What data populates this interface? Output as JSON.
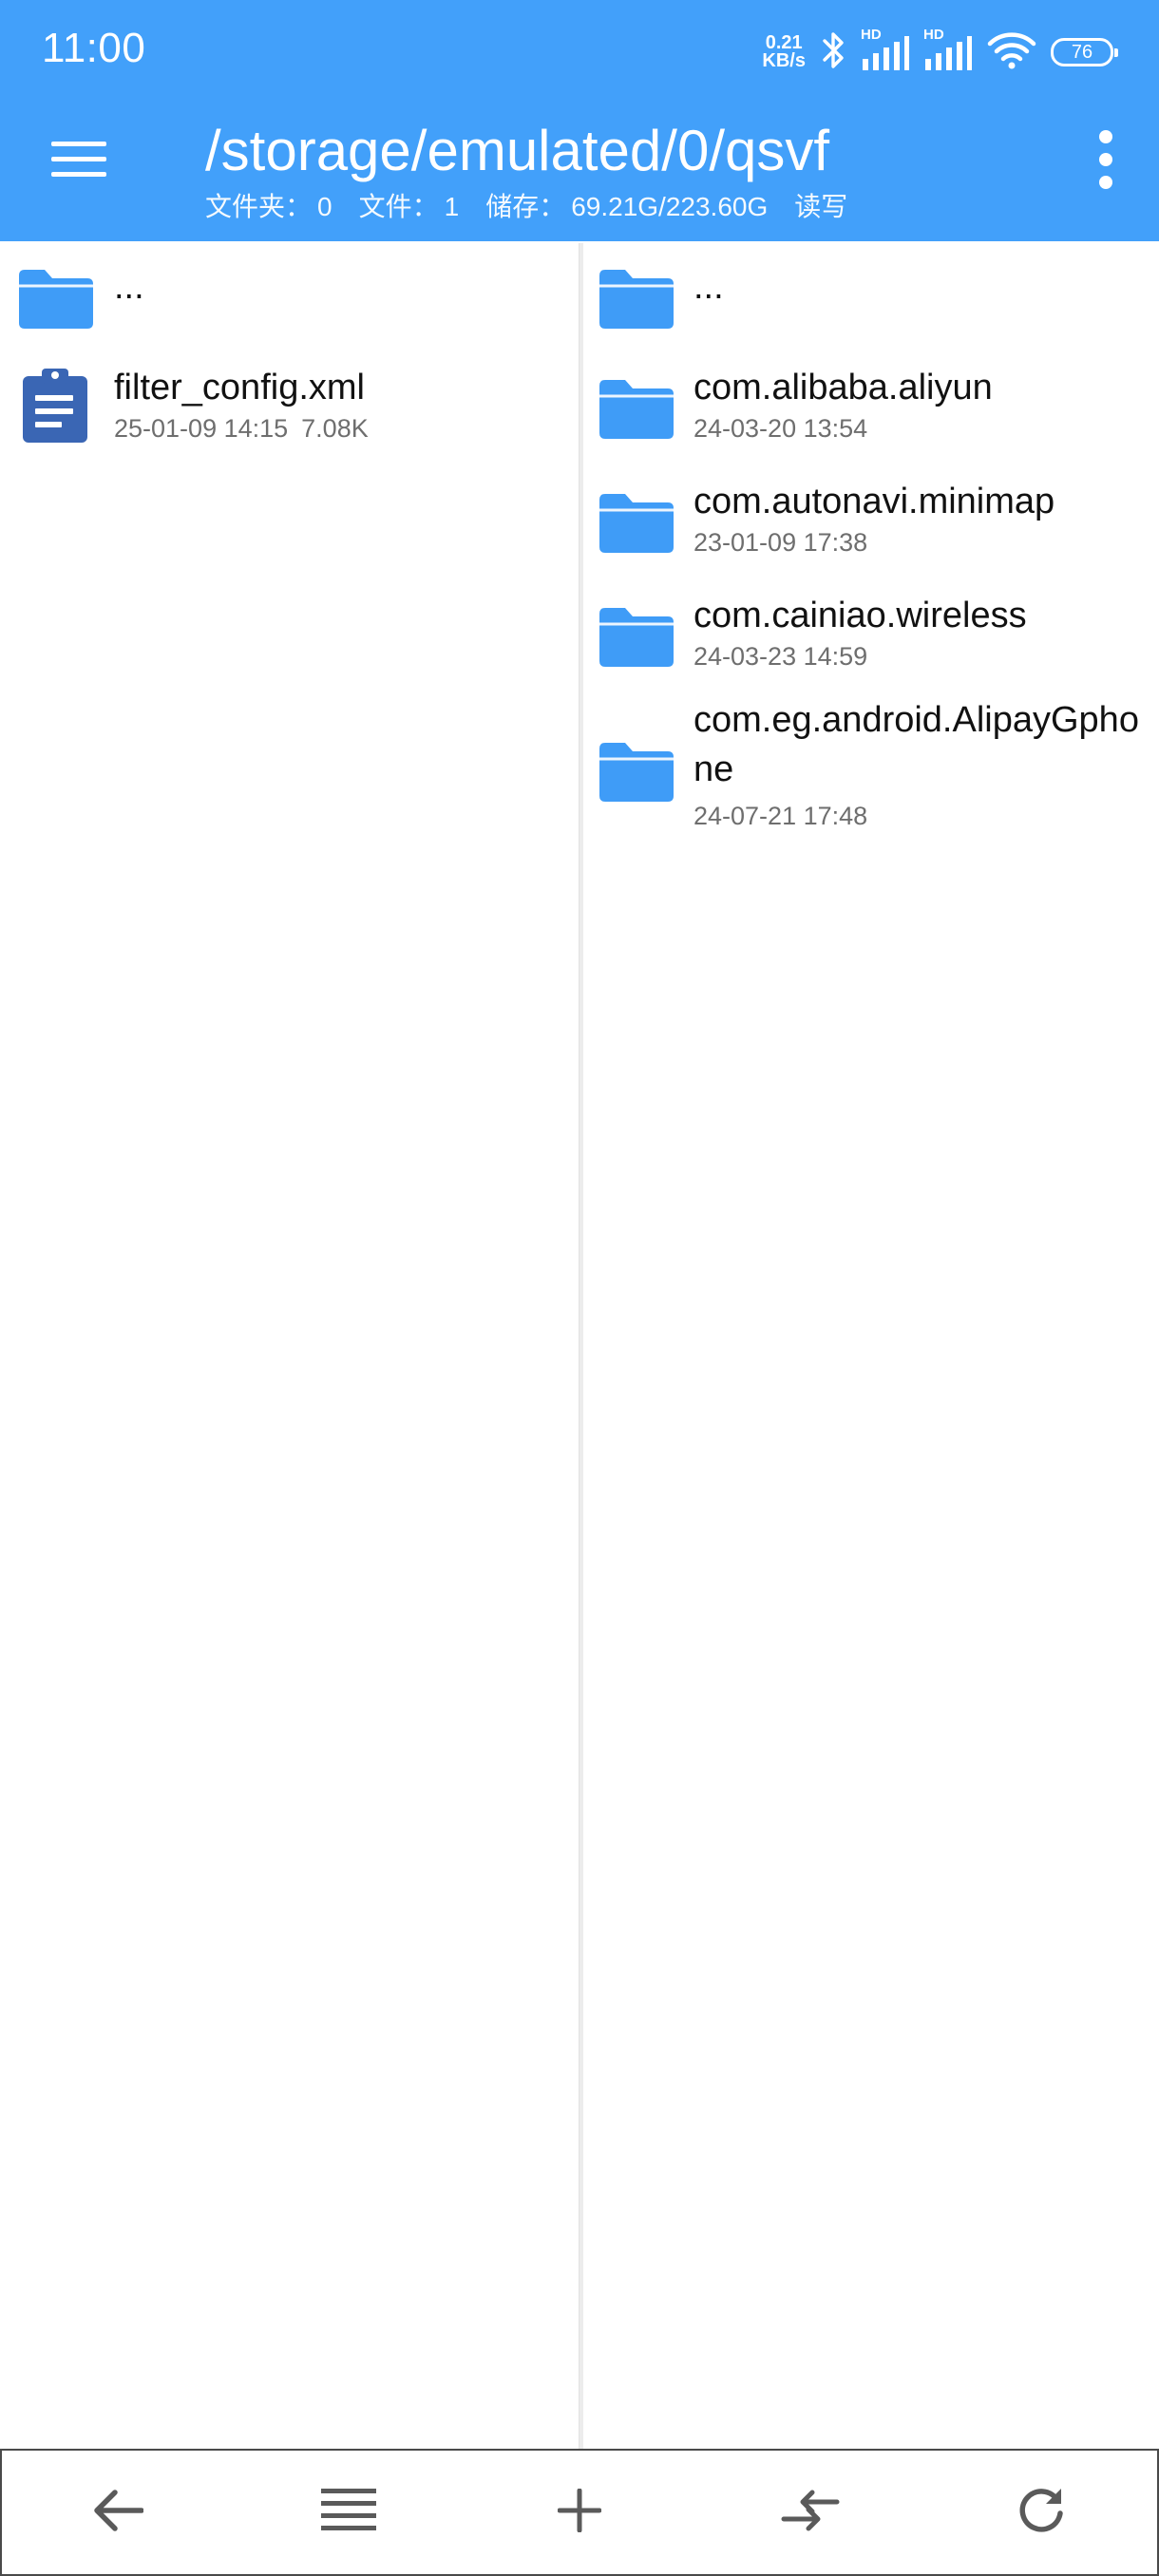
{
  "status_bar": {
    "time": "11:00",
    "net_speed_value": "0.21",
    "net_speed_unit": "KB/s",
    "hd_label_1": "HD",
    "hd_label_2": "HD",
    "battery": "76",
    "icons": [
      "bluetooth-icon",
      "signal-icon",
      "wifi-icon",
      "battery-icon"
    ]
  },
  "app_bar": {
    "path": "/storage/emulated/0/qsvf",
    "folders_label": "文件夹：",
    "folders_count": "0",
    "files_label": "文件：",
    "files_count": "1",
    "storage_label": "储存：",
    "storage_value": "69.21G/223.60G",
    "permission": "读写",
    "icons": [
      "menu-icon",
      "more-vert-icon"
    ]
  },
  "left_pane": {
    "items": [
      {
        "type": "folder",
        "name": "...",
        "date": "",
        "size": ""
      },
      {
        "type": "file",
        "name": "filter_config.xml",
        "date": "25-01-09 14:15",
        "size": "7.08K"
      }
    ]
  },
  "right_pane": {
    "items": [
      {
        "type": "folder",
        "name": "...",
        "date": ""
      },
      {
        "type": "folder",
        "name": "com.alibaba.aliyun",
        "date": "24-03-20 13:54"
      },
      {
        "type": "folder",
        "name": "com.autonavi.minimap",
        "date": "23-01-09 17:38"
      },
      {
        "type": "folder",
        "name": "com.cainiao.wireless",
        "date": "24-03-23 14:59"
      },
      {
        "type": "folder",
        "name": "com.eg.android.AlipayGphone",
        "date": "24-07-21 17:48"
      }
    ]
  },
  "bottom_bar": {
    "icons": [
      "back-arrow-icon",
      "list-icon",
      "add-icon",
      "swap-icon",
      "refresh-icon"
    ]
  },
  "colors": {
    "primary": "#42a0fa",
    "folder": "#3f9cf7",
    "file_icon": "#3a66b4",
    "meta_text": "#6e6e6e"
  }
}
